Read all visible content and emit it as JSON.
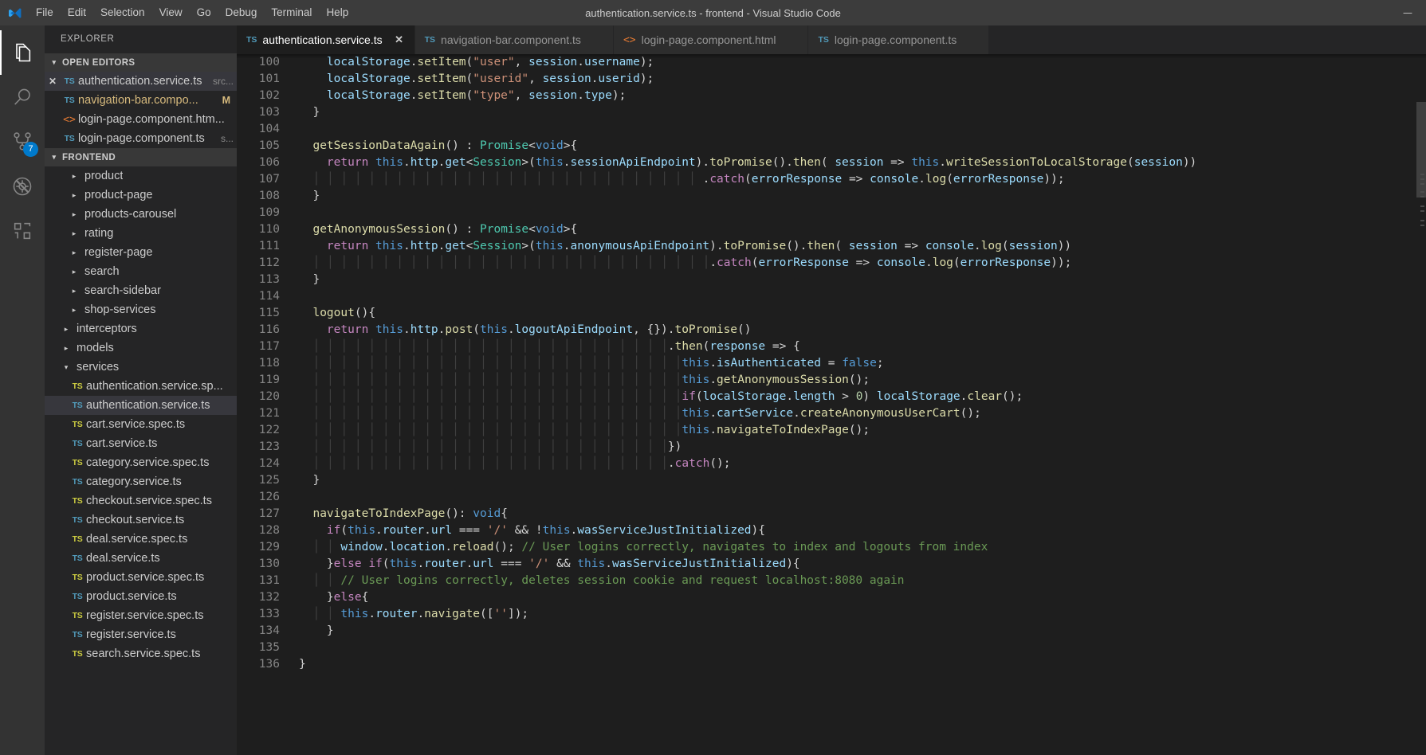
{
  "titlebar": {
    "window_title": "authentication.service.ts - frontend - Visual Studio Code",
    "logo_name": "vscode-logo",
    "menus": [
      "File",
      "Edit",
      "Selection",
      "View",
      "Go",
      "Debug",
      "Terminal",
      "Help"
    ],
    "minimize_label": "—"
  },
  "activitybar": {
    "items": [
      {
        "name": "explorer-icon",
        "active": true,
        "badge": ""
      },
      {
        "name": "search-icon",
        "active": false,
        "badge": ""
      },
      {
        "name": "source-control-icon",
        "active": false,
        "badge": "7"
      },
      {
        "name": "debug-icon",
        "active": false,
        "badge": ""
      },
      {
        "name": "extensions-icon",
        "active": false,
        "badge": ""
      }
    ]
  },
  "sidebar": {
    "title": "EXPLORER",
    "open_editors": {
      "header": "OPEN EDITORS",
      "twisty": "expanded",
      "items": [
        {
          "icon": "ts",
          "label": "authentication.service.ts",
          "suffix": "src...",
          "selected": true,
          "dirty": false,
          "closable": true
        },
        {
          "icon": "ts",
          "label": "navigation-bar.compo...",
          "suffix": "",
          "selected": false,
          "dirty": true,
          "badge": "M"
        },
        {
          "icon": "html",
          "label": "login-page.component.htm...",
          "suffix": "",
          "selected": false,
          "dirty": false
        },
        {
          "icon": "ts",
          "label": "login-page.component.ts",
          "suffix": "s...",
          "selected": false,
          "dirty": false
        }
      ]
    },
    "workspace": {
      "header": "FRONTEND",
      "twisty": "expanded",
      "items": [
        {
          "kind": "folder",
          "label": "product",
          "indent": 3,
          "twisty": "collapsed"
        },
        {
          "kind": "folder",
          "label": "product-page",
          "indent": 3,
          "twisty": "collapsed"
        },
        {
          "kind": "folder",
          "label": "products-carousel",
          "indent": 3,
          "twisty": "collapsed"
        },
        {
          "kind": "folder",
          "label": "rating",
          "indent": 3,
          "twisty": "collapsed"
        },
        {
          "kind": "folder",
          "label": "register-page",
          "indent": 3,
          "twisty": "collapsed"
        },
        {
          "kind": "folder",
          "label": "search",
          "indent": 3,
          "twisty": "collapsed"
        },
        {
          "kind": "folder",
          "label": "search-sidebar",
          "indent": 3,
          "twisty": "collapsed"
        },
        {
          "kind": "folder",
          "label": "shop-services",
          "indent": 3,
          "twisty": "collapsed"
        },
        {
          "kind": "folder",
          "label": "interceptors",
          "indent": 2,
          "twisty": "collapsed"
        },
        {
          "kind": "folder",
          "label": "models",
          "indent": 2,
          "twisty": "collapsed"
        },
        {
          "kind": "folder",
          "label": "services",
          "indent": 2,
          "twisty": "expanded"
        },
        {
          "kind": "file",
          "icon": "ts-spec",
          "label": "authentication.service.sp...",
          "indent": 3
        },
        {
          "kind": "file",
          "icon": "ts",
          "label": "authentication.service.ts",
          "indent": 3,
          "selected": true
        },
        {
          "kind": "file",
          "icon": "ts-spec",
          "label": "cart.service.spec.ts",
          "indent": 3
        },
        {
          "kind": "file",
          "icon": "ts",
          "label": "cart.service.ts",
          "indent": 3
        },
        {
          "kind": "file",
          "icon": "ts-spec",
          "label": "category.service.spec.ts",
          "indent": 3
        },
        {
          "kind": "file",
          "icon": "ts",
          "label": "category.service.ts",
          "indent": 3
        },
        {
          "kind": "file",
          "icon": "ts-spec",
          "label": "checkout.service.spec.ts",
          "indent": 3
        },
        {
          "kind": "file",
          "icon": "ts",
          "label": "checkout.service.ts",
          "indent": 3
        },
        {
          "kind": "file",
          "icon": "ts-spec",
          "label": "deal.service.spec.ts",
          "indent": 3
        },
        {
          "kind": "file",
          "icon": "ts",
          "label": "deal.service.ts",
          "indent": 3
        },
        {
          "kind": "file",
          "icon": "ts-spec",
          "label": "product.service.spec.ts",
          "indent": 3
        },
        {
          "kind": "file",
          "icon": "ts",
          "label": "product.service.ts",
          "indent": 3
        },
        {
          "kind": "file",
          "icon": "ts-spec",
          "label": "register.service.spec.ts",
          "indent": 3
        },
        {
          "kind": "file",
          "icon": "ts",
          "label": "register.service.ts",
          "indent": 3
        },
        {
          "kind": "file",
          "icon": "ts-spec",
          "label": "search.service.spec.ts",
          "indent": 3
        }
      ]
    }
  },
  "editor": {
    "tabs": [
      {
        "icon": "ts",
        "label": "authentication.service.ts",
        "active": true
      },
      {
        "icon": "ts",
        "label": "navigation-bar.component.ts",
        "active": false
      },
      {
        "icon": "html",
        "label": "login-page.component.html",
        "active": false
      },
      {
        "icon": "ts",
        "label": "login-page.component.ts",
        "active": false
      }
    ],
    "close_glyph": "✕",
    "first_line_number": 100,
    "last_line_number": 136,
    "line_numbers": [
      100,
      101,
      102,
      103,
      104,
      105,
      106,
      107,
      108,
      109,
      110,
      111,
      112,
      113,
      114,
      115,
      116,
      117,
      118,
      119,
      120,
      121,
      122,
      123,
      124,
      125,
      126,
      127,
      128,
      129,
      130,
      131,
      132,
      133,
      134,
      135,
      136
    ],
    "lines": [
      "    localStorage.setItem(\"user\", session.username);",
      "    localStorage.setItem(\"userid\", session.userid);",
      "    localStorage.setItem(\"type\", session.type);",
      "  }",
      "",
      "  getSessionDataAgain() : Promise<void>{",
      "    return this.http.get<Session>(this.sessionApiEndpoint).toPromise().then( session => this.writeSessionToLocalStorage(session))",
      "                                                          .catch(errorResponse => console.log(errorResponse));",
      "  }",
      "",
      "  getAnonymousSession() : Promise<void>{",
      "    return this.http.get<Session>(this.anonymousApiEndpoint).toPromise().then( session => console.log(session))",
      "                                                           .catch(errorResponse => console.log(errorResponse));",
      "  }",
      "",
      "  logout(){",
      "    return this.http.post(this.logoutApiEndpoint, {}).toPromise()",
      "                                                     .then(response => {",
      "                                                       this.isAuthenticated = false;",
      "                                                       this.getAnonymousSession();",
      "                                                       if(localStorage.length > 0) localStorage.clear();",
      "                                                       this.cartService.createAnonymousUserCart();",
      "                                                       this.navigateToIndexPage();",
      "                                                     })",
      "                                                     .catch();",
      "  }",
      "",
      "  navigateToIndexPage(): void{",
      "    if(this.router.url === '/' && !this.wasServiceJustInitialized){",
      "      window.location.reload(); // User logins correctly, navigates to index and logouts from index",
      "    }else if(this.router.url === '/' && this.wasServiceJustInitialized){",
      "      // User logins correctly, deletes session cookie and request localhost:8080 again",
      "    }else{",
      "      this.router.navigate(['']);",
      "    }",
      "",
      "}"
    ]
  },
  "colors": {
    "accent": "#007acc",
    "editor_bg": "#1e1e1e",
    "sidebar_bg": "#252526",
    "activitybar_bg": "#333333",
    "titlebar_bg": "#3c3c3c",
    "selection_bg": "#37373d"
  }
}
